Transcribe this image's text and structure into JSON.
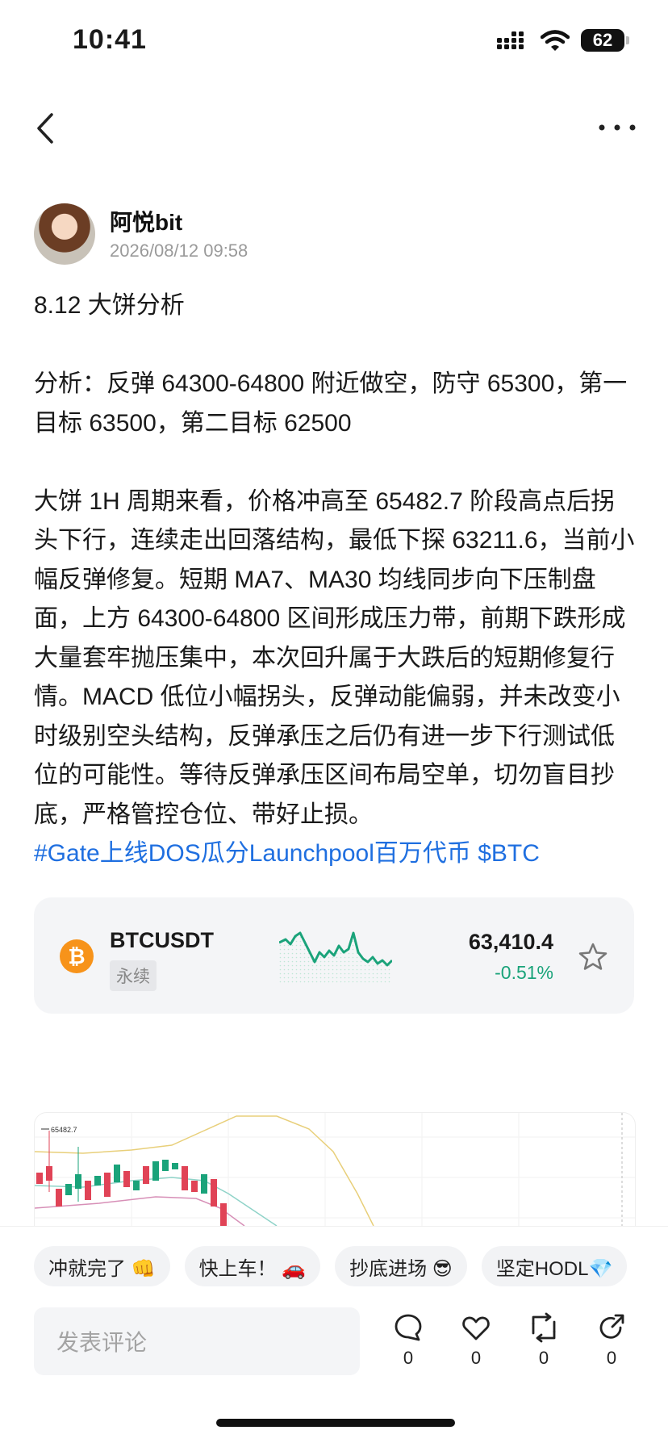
{
  "status_bar": {
    "time": "10:41",
    "battery": "62"
  },
  "nav": {
    "back_icon": "chevron-left-icon",
    "more_icon": "more-icon"
  },
  "author": {
    "name": "阿悦bit",
    "time": "2026/08/12 09:58"
  },
  "post": {
    "title": "8.12 大饼分析",
    "analysis": "分析：反弹 64300-64800 附近做空，防守 65300，第一目标 63500，第二目标 62500",
    "body": "大饼 1H 周期来看，价格冲高至 65482.7 阶段高点后拐头下行，连续走出回落结构，最低下探 63211.6，当前小幅反弹修复。短期 MA7、MA30 均线同步向下压制盘面，上方 64300-64800 区间形成压力带，前期下跌形成大量套牢抛压集中，本次回升属于大跌后的短期修复行情。MACD 低位小幅拐头，反弹动能偏弱，并未改变小时级别空头结构，反弹承压之后仍有进一步下行测试低位的可能性。等待反弹承压区间布局空单，切勿盲目抄底，严格管控仓位、带好止损。",
    "hashtag": "#Gate上线DOS瓜分Launchpool百万代币 $BTC"
  },
  "market_card": {
    "symbol": "BTCUSDT",
    "contract_type": "永续",
    "price": "63,410.4",
    "change": "-0.51%",
    "coin_icon": "bitcoin-icon",
    "star_icon": "star-icon",
    "colors": {
      "up": "#1aa37a",
      "coin": "#f7931a"
    }
  },
  "kline_image": {
    "high_label": "65482.7"
  },
  "quick_replies": [
    "冲就完了 👊",
    "快上车！ 🚗",
    "抄底进场 😎",
    "坚定HODL💎"
  ],
  "comment": {
    "placeholder": "发表评论"
  },
  "actions": [
    {
      "icon": "comment-icon",
      "count": "0"
    },
    {
      "icon": "heart-icon",
      "count": "0"
    },
    {
      "icon": "repost-icon",
      "count": "0"
    },
    {
      "icon": "share-icon",
      "count": "0"
    }
  ]
}
